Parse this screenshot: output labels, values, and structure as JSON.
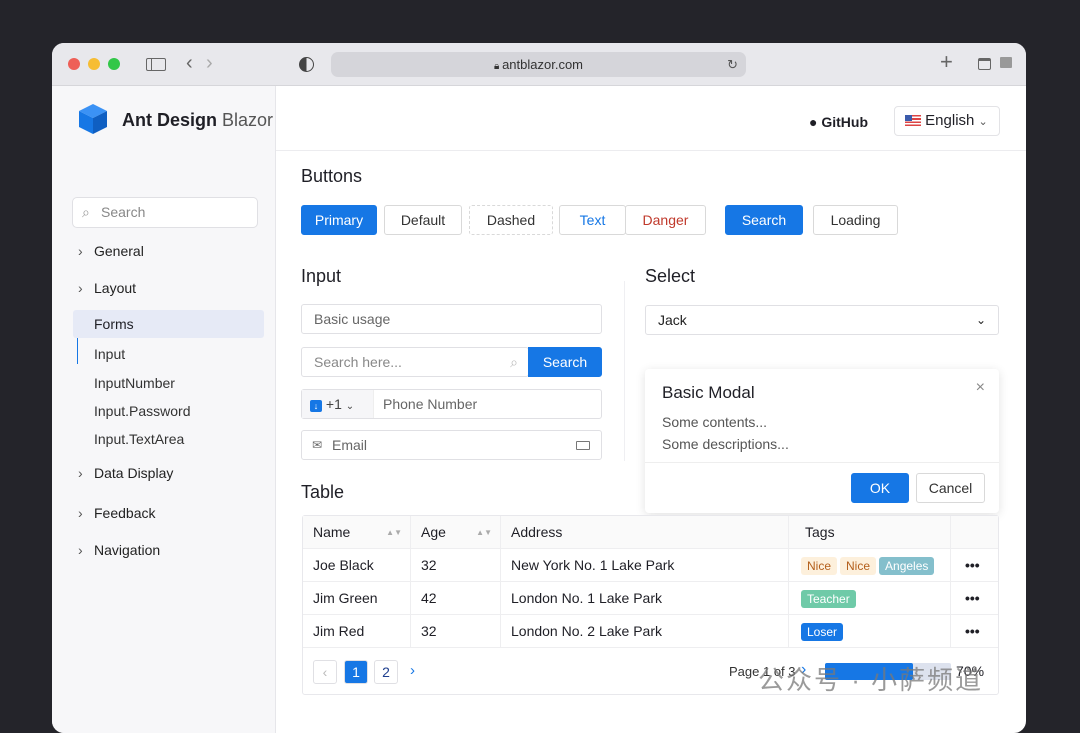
{
  "browser": {
    "url": "antblazor.com"
  },
  "brand": {
    "name_bold": "Ant Design",
    "name_light": "Blazor",
    "color": "#1677e5"
  },
  "header": {
    "github": "GitHub",
    "language": "English"
  },
  "sidebar": {
    "search_placeholder": "Search",
    "items": [
      {
        "label": "General"
      },
      {
        "label": "Layout"
      },
      {
        "label": "Forms"
      },
      {
        "label": "Data Display"
      },
      {
        "label": "Feedback"
      },
      {
        "label": "Navigation"
      }
    ],
    "sub_items": [
      "Input",
      "InputNumber",
      "Input.Password",
      "Input.TextArea"
    ]
  },
  "buttons": {
    "title": "Buttons",
    "items": [
      "Primary",
      "Default",
      "Dashed",
      "Text",
      "Danger",
      "Search",
      "Loading"
    ]
  },
  "input": {
    "title": "Input",
    "basic": "Basic usage",
    "search_placeholder": "Search here...",
    "search_button": "Search",
    "phone_code": "+1",
    "phone_placeholder": "Phone Number",
    "email_placeholder": "Email"
  },
  "select": {
    "title": "Select",
    "value": "Jack"
  },
  "modal": {
    "title": "Basic Modal",
    "line1": "Some contents...",
    "line2": "Some descriptions...",
    "ok": "OK",
    "cancel": "Cancel"
  },
  "table": {
    "title": "Table",
    "columns": [
      "Name",
      "Age",
      "Address",
      "Tags"
    ],
    "rows": [
      {
        "name": "Joe Black",
        "age": "32",
        "address": "New York No. 1 Lake Park",
        "tags": [
          "Nice",
          "Nice",
          "Angeles"
        ]
      },
      {
        "name": "Jim Green",
        "age": "42",
        "address": "London No. 1 Lake Park",
        "tags": [
          "Teacher"
        ]
      },
      {
        "name": "Jim Red",
        "age": "32",
        "address": "London No. 2 Lake Park",
        "tags": [
          "Loser"
        ]
      }
    ],
    "pages": [
      "1",
      "2"
    ],
    "page_info": "Page 1 of 3",
    "progress_percent": 70,
    "progress_label": "70%"
  },
  "watermark": "公众号 · 小萨频道"
}
